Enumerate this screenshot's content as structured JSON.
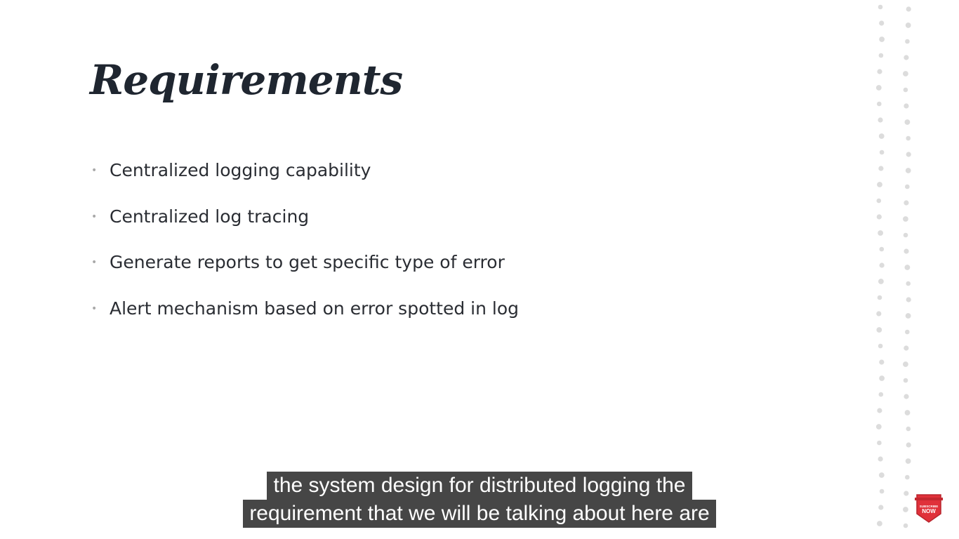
{
  "slide": {
    "title": "Requirements",
    "bullets": [
      "Centralized logging capability",
      "Centralized log tracing",
      "Generate reports to get specific type of error",
      "Alert mechanism based on error spotted in log"
    ],
    "bullet_glyph": "•"
  },
  "captions": {
    "line1": "the system design for distributed logging the",
    "line2": "requirement that we will be talking about here are"
  },
  "badge": {
    "top_text": "SUBSCRIBE",
    "main_text": "NOW",
    "color": "#e0313a"
  },
  "colors": {
    "title": "#1f2630",
    "text": "#2a2d33",
    "bullet": "#a9a9a9",
    "dots": "#dcdcdc"
  }
}
